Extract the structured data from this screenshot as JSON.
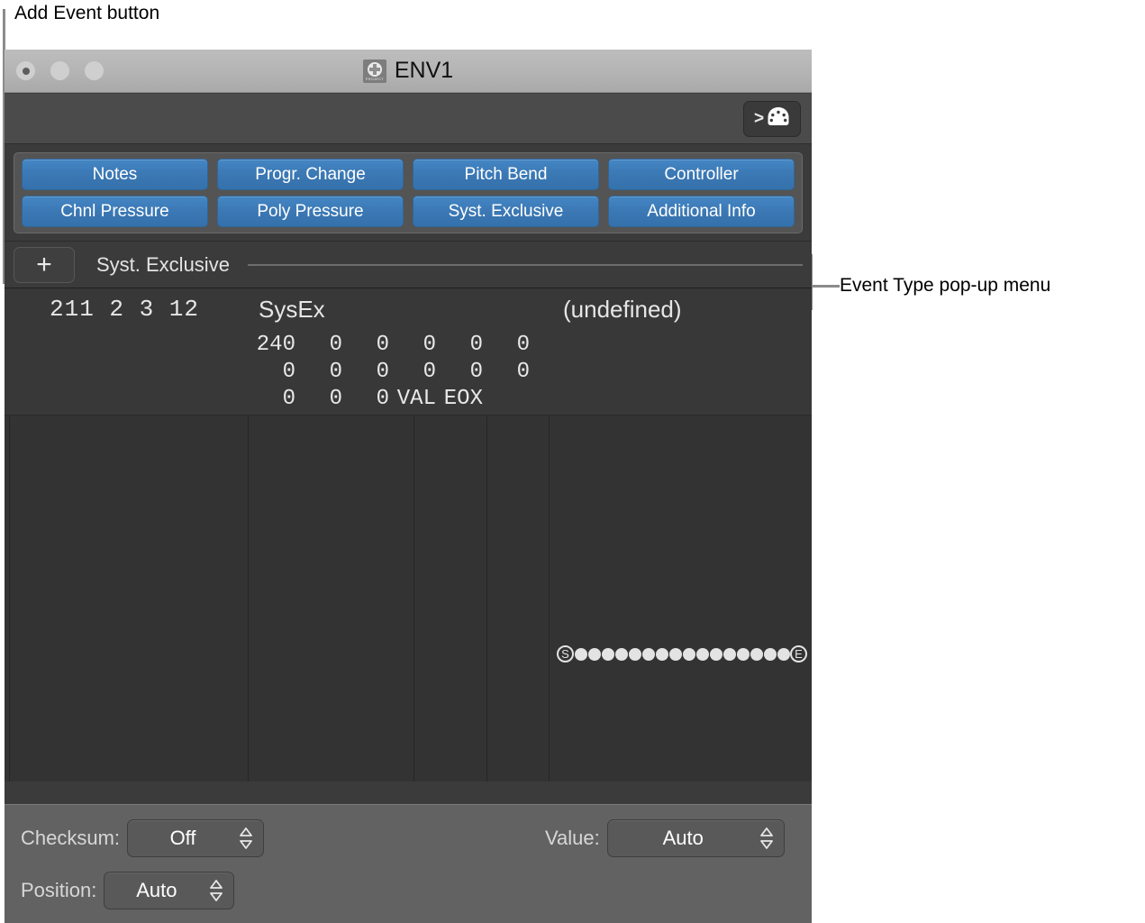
{
  "annotations": {
    "add_event": "Add Event button",
    "event_type_popup": "Event Type pop-up menu"
  },
  "window": {
    "title": "ENV1",
    "project_icon_caption": "PROJECT",
    "traffic_lights": [
      "close-button",
      "minimize-button",
      "zoom-button"
    ]
  },
  "toolbar": {
    "midi_button_chevron": ">",
    "midi_icon": "midi-din-icon"
  },
  "event_types": {
    "row1": [
      "Notes",
      "Progr. Change",
      "Pitch Bend",
      "Controller"
    ],
    "row2": [
      "Chnl Pressure",
      "Poly Pressure",
      "Syst. Exclusive",
      "Additional Info"
    ],
    "accent_color": "#3b78b4"
  },
  "add_row": {
    "add_button_glyph": "+",
    "popup_value": "Syst. Exclusive"
  },
  "event_list": {
    "row": {
      "position": "211 2 3  12",
      "status": "SysEx",
      "channel_label": "(undefined)",
      "sysex_bytes": [
        [
          "240",
          "0",
          "0",
          "0",
          "0",
          "0"
        ],
        [
          "0",
          "0",
          "0",
          "0",
          "0",
          "0"
        ],
        [
          "0",
          "0",
          "0",
          "VAL",
          "EOX",
          ""
        ]
      ],
      "length_start_marker": "S",
      "length_end_marker": "E",
      "length_dot_count": 16
    }
  },
  "footer": {
    "checksum_label": "Checksum:",
    "checksum_value": "Off",
    "value_label": "Value:",
    "value_value": "Auto",
    "position_label": "Position:",
    "position_value": "Auto"
  }
}
